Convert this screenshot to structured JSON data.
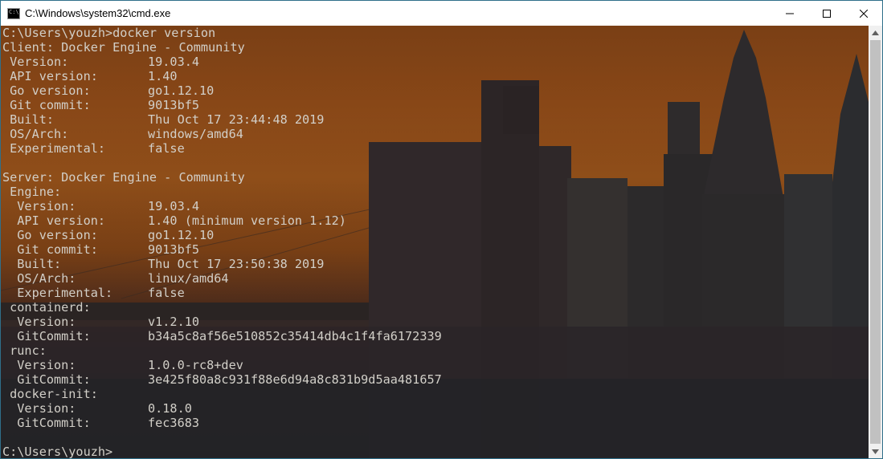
{
  "window": {
    "title": "C:\\Windows\\system32\\cmd.exe",
    "icon_label": "C:\\"
  },
  "controls": [
    "minimize-icon",
    "maximize-icon",
    "close-icon"
  ],
  "console": {
    "lines": [
      {
        "key": "C:\\Users\\youzh>docker version",
        "value": ""
      },
      {
        "key": "Client: Docker Engine - Community",
        "value": ""
      },
      {
        "key": " Version:",
        "value": "19.03.4"
      },
      {
        "key": " API version:",
        "value": "1.40"
      },
      {
        "key": " Go version:",
        "value": "go1.12.10"
      },
      {
        "key": " Git commit:",
        "value": "9013bf5"
      },
      {
        "key": " Built:",
        "value": "Thu Oct 17 23:44:48 2019"
      },
      {
        "key": " OS/Arch:",
        "value": "windows/amd64"
      },
      {
        "key": " Experimental:",
        "value": "false"
      },
      {
        "key": "",
        "value": ""
      },
      {
        "key": "Server: Docker Engine - Community",
        "value": ""
      },
      {
        "key": " Engine:",
        "value": ""
      },
      {
        "key": "  Version:",
        "value": "19.03.4"
      },
      {
        "key": "  API version:",
        "value": "1.40 (minimum version 1.12)"
      },
      {
        "key": "  Go version:",
        "value": "go1.12.10"
      },
      {
        "key": "  Git commit:",
        "value": "9013bf5"
      },
      {
        "key": "  Built:",
        "value": "Thu Oct 17 23:50:38 2019"
      },
      {
        "key": "  OS/Arch:",
        "value": "linux/amd64"
      },
      {
        "key": "  Experimental:",
        "value": "false"
      },
      {
        "key": " containerd:",
        "value": ""
      },
      {
        "key": "  Version:",
        "value": "v1.2.10"
      },
      {
        "key": "  GitCommit:",
        "value": "b34a5c8af56e510852c35414db4c1f4fa6172339"
      },
      {
        "key": " runc:",
        "value": ""
      },
      {
        "key": "  Version:",
        "value": "1.0.0-rc8+dev"
      },
      {
        "key": "  GitCommit:",
        "value": "3e425f80a8c931f88e6d94a8c831b9d5aa481657"
      },
      {
        "key": " docker-init:",
        "value": ""
      },
      {
        "key": "  Version:",
        "value": "0.18.0"
      },
      {
        "key": "  GitCommit:",
        "value": "fec3683"
      },
      {
        "key": "",
        "value": ""
      },
      {
        "key": "C:\\Users\\youzh>",
        "value": ""
      }
    ]
  },
  "colors": {
    "console_text": "#d2cfc8",
    "titlebar": "#ffffff",
    "border": "#2f6f8a"
  }
}
